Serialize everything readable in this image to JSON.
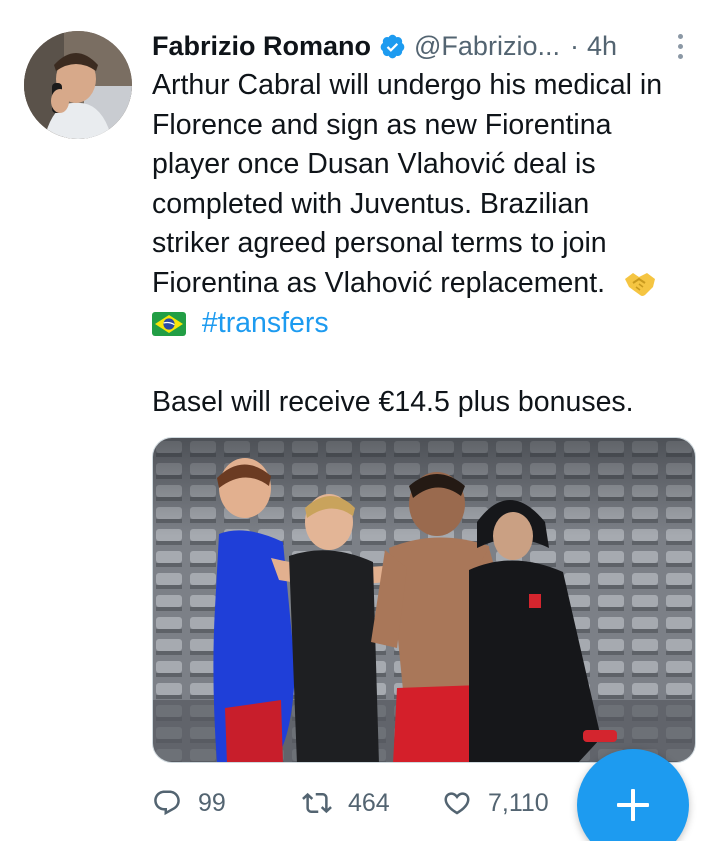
{
  "author": {
    "display_name": "Fabrizio Romano",
    "handle": "@Fabrizio...",
    "separator": "·",
    "time": "4h",
    "verified": true
  },
  "tweet": {
    "lines": [
      "Arthur Cabral will undergo his medical in",
      "Florence and sign as new Fiorentina",
      "player once Dusan Vlahović deal is",
      "completed with Juventus. Brazilian",
      "striker agreed personal terms to join",
      "Fiorentina as Vlahović replacement."
    ],
    "emoji_handshake": "handshake-emoji",
    "emoji_flag": "brazil-flag-emoji",
    "hashtag": "#transfers",
    "footer_line": "Basel will receive €14.5 plus bonuses."
  },
  "media": {
    "icon": "photo-players-celebrating"
  },
  "actions": {
    "reply_count": "99",
    "retweet_count": "464",
    "like_count": "7,110"
  },
  "fab": {
    "icon": "plus-icon"
  },
  "colors": {
    "accent": "#1d9bf0",
    "secondary_text": "#536471",
    "primary_text": "#0f1419"
  }
}
